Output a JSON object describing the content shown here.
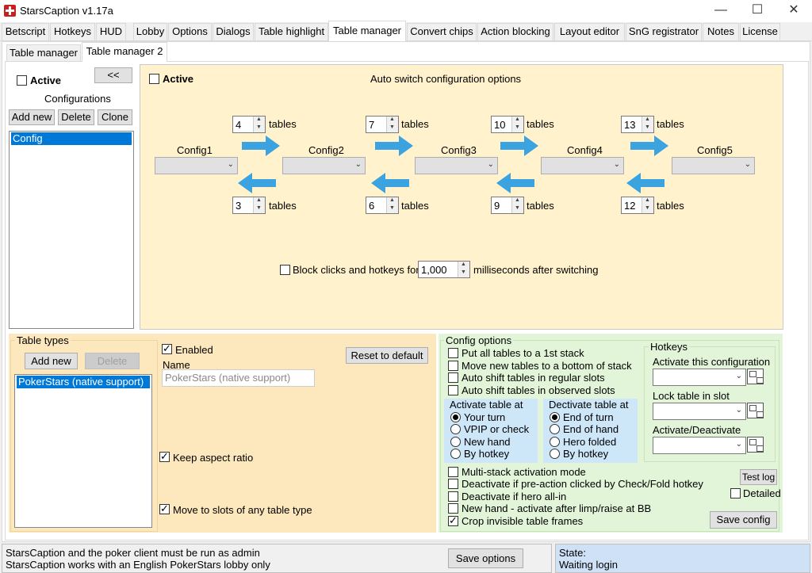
{
  "window": {
    "title": "StarsCaption v1.17a",
    "minimize": "—",
    "maximize": "☐",
    "close": "✕"
  },
  "tabs": [
    "Betscript",
    "Hotkeys",
    "HUD",
    "Lobby",
    "Options",
    "Dialogs",
    "Table highlight",
    "Table manager",
    "Convert chips",
    "Action blocking",
    "Layout editor",
    "SnG registrator",
    "Notes",
    "License"
  ],
  "subtabs": [
    "Table manager",
    "Table manager 2"
  ],
  "left_panel": {
    "active_label": "Active",
    "collapse_button": "<<",
    "configurations_label": "Configurations",
    "add_new": "Add new",
    "delete": "Delete",
    "clone": "Clone",
    "configs": [
      "Config"
    ]
  },
  "auto_switch": {
    "active_label": "Active",
    "title": "Auto switch configuration options",
    "configs": [
      "Config1",
      "Config2",
      "Config3",
      "Config4",
      "Config5"
    ],
    "up_tables": [
      "4",
      "7",
      "10",
      "13"
    ],
    "down_tables": [
      "3",
      "6",
      "9",
      "12"
    ],
    "tables_word": "tables",
    "block_label_pre": "Block clicks and hotkeys for",
    "block_value": "1,000",
    "block_label_post": "milliseconds after switching"
  },
  "table_types": {
    "group_title": "Table types",
    "add_new": "Add new",
    "delete": "Delete",
    "items": [
      "PokerStars (native support)"
    ],
    "enabled_label": "Enabled",
    "name_label": "Name",
    "name_value": "PokerStars (native support)",
    "reset_button": "Reset to default",
    "keep_aspect": "Keep aspect ratio",
    "move_slots": "Move to slots of any table type"
  },
  "config_options": {
    "group_title": "Config options",
    "checks": [
      "Put all tables to a 1st stack",
      "Move new tables to a bottom of stack",
      "Auto shift tables in regular slots",
      "Auto shift tables in observed slots"
    ],
    "activate_title": "Activate table at",
    "activate_options": [
      "Your turn",
      "VPIP or check",
      "New hand",
      "By hotkey"
    ],
    "deactivate_title": "Dectivate table at",
    "deactivate_options": [
      "End of turn",
      "End of hand",
      "Hero folded",
      "By hotkey"
    ],
    "bottom_checks": [
      "Multi-stack activation mode",
      "Deactivate if pre-action clicked by Check/Fold hotkey",
      "Deactivate if hero all-in",
      "New hand - activate after limp/raise at BB",
      "Crop invisible table frames"
    ],
    "test_log": "Test log",
    "detailed": "Detailed",
    "save_config": "Save config"
  },
  "hotkeys": {
    "group_title": "Hotkeys",
    "labels": [
      "Activate this configuration",
      "Lock table in slot",
      "Activate/Deactivate"
    ]
  },
  "status": {
    "line1": "StarsCaption and the poker client must be run as admin",
    "line2": "StarsCaption works with an English PokerStars lobby only",
    "save_options": "Save options",
    "state_label": "State:",
    "state_value": "Waiting login"
  },
  "colors": {
    "accent_blue": "#0078d7",
    "arrow_blue": "#3ba3e0",
    "yellow_panel": "#fff2cc",
    "orange_panel": "#fde7bd",
    "green_panel": "#e2f5d9",
    "light_blue_box": "#cde6f8",
    "status_blue": "#cfe1f6"
  }
}
